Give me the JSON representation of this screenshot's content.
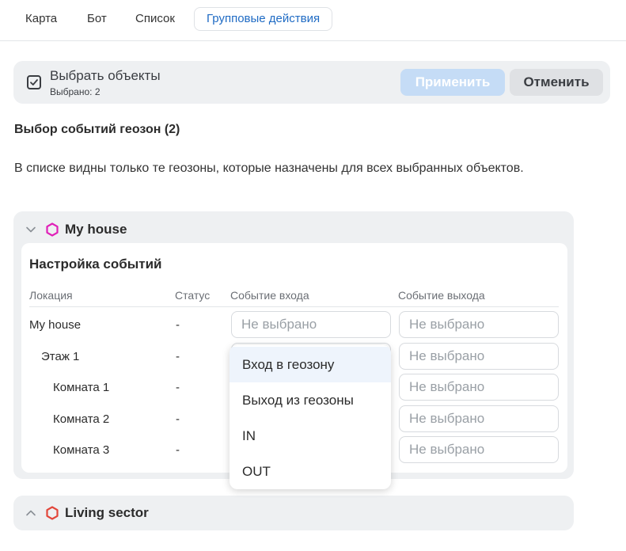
{
  "tabs": [
    {
      "label": "Карта"
    },
    {
      "label": "Бот"
    },
    {
      "label": "Список"
    },
    {
      "label": "Групповые действия",
      "active": true
    }
  ],
  "select_objects": {
    "title": "Выбрать объекты",
    "count_text": "Выбрано: 2",
    "apply_label": "Применить",
    "cancel_label": "Отменить"
  },
  "section_title": "Выбор событий геозон (2)",
  "info_text": "В списке видны только те геозоны, которые назначены для всех выбранных объектов.",
  "geozones": [
    {
      "name": "My house",
      "expanded": true,
      "hex_color": "#e020b8",
      "events": {
        "title": "Настройка событий",
        "columns": [
          "Локация",
          "Статус",
          "Событие входа",
          "Событие выхода"
        ],
        "rows": [
          {
            "location": "My house",
            "status": "-",
            "enter": "Не выбрано",
            "exit": "Не выбрано"
          },
          {
            "location": "Этаж 1",
            "status": "-",
            "enter": "",
            "exit": "Не выбрано"
          },
          {
            "location": "Комната 1",
            "status": "-",
            "enter": "",
            "exit": "Не выбрано"
          },
          {
            "location": "Комната 2",
            "status": "-",
            "enter": "",
            "exit": "Не выбрано"
          },
          {
            "location": "Комната 3",
            "status": "-",
            "enter": "",
            "exit": "Не выбрано"
          }
        ]
      }
    },
    {
      "name": "Living sector",
      "expanded": false,
      "hex_color": "#e2463a"
    }
  ],
  "dropdown": {
    "options": [
      "Вход в геозону",
      "Выход из геозоны",
      "IN",
      "OUT"
    ],
    "highlighted": "Вход в геозону"
  },
  "colors": {
    "accent": "#1f6bc4",
    "apply_disabled": "#c5dcf6",
    "panel_bg": "#eef0f2"
  }
}
